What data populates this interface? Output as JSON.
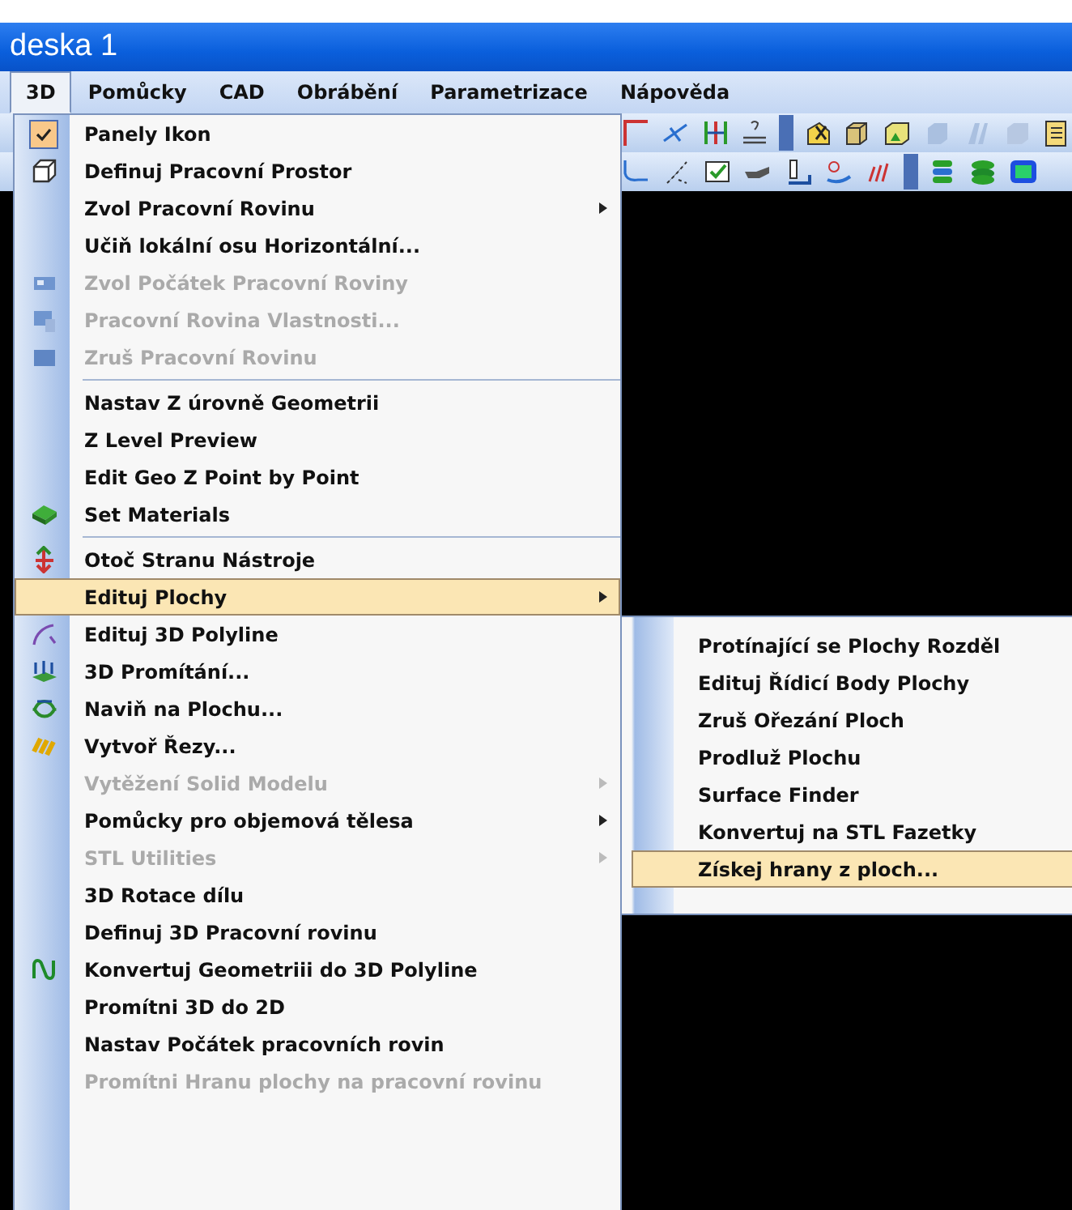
{
  "window": {
    "title": "deska 1"
  },
  "menubar": [
    {
      "label": "3D",
      "selected": true
    },
    {
      "label": "Pomůcky",
      "selected": false
    },
    {
      "label": "CAD",
      "selected": false
    },
    {
      "label": "Obrábění",
      "selected": false
    },
    {
      "label": "Parametrizace",
      "selected": false
    },
    {
      "label": "Nápověda",
      "selected": false
    }
  ],
  "dropdown": {
    "items": [
      {
        "kind": "item",
        "label": "Panely Ikon",
        "checked": true,
        "disabled": false,
        "submenu": false,
        "selected": false
      },
      {
        "kind": "item",
        "label": "Definuj Pracovní Prostor",
        "checked": false,
        "disabled": false,
        "submenu": false,
        "selected": false
      },
      {
        "kind": "item",
        "label": "Zvol Pracovní Rovinu",
        "checked": false,
        "disabled": false,
        "submenu": true,
        "selected": false
      },
      {
        "kind": "item",
        "label": "Učiň lokální osu Horizontální...",
        "checked": false,
        "disabled": false,
        "submenu": false,
        "selected": false
      },
      {
        "kind": "item",
        "label": "Zvol Počátek Pracovní Roviny",
        "checked": false,
        "disabled": true,
        "submenu": false,
        "selected": false
      },
      {
        "kind": "item",
        "label": "Pracovní Rovina Vlastnosti...",
        "checked": false,
        "disabled": true,
        "submenu": false,
        "selected": false
      },
      {
        "kind": "item",
        "label": "Zruš Pracovní Rovinu",
        "checked": false,
        "disabled": true,
        "submenu": false,
        "selected": false
      },
      {
        "kind": "separator"
      },
      {
        "kind": "item",
        "label": "Nastav Z úrovně Geometrii",
        "checked": false,
        "disabled": false,
        "submenu": false,
        "selected": false
      },
      {
        "kind": "item",
        "label": "Z Level Preview",
        "checked": false,
        "disabled": false,
        "submenu": false,
        "selected": false
      },
      {
        "kind": "item",
        "label": "Edit Geo Z Point by Point",
        "checked": false,
        "disabled": false,
        "submenu": false,
        "selected": false
      },
      {
        "kind": "item",
        "label": "Set Materials",
        "checked": false,
        "disabled": false,
        "submenu": false,
        "selected": false
      },
      {
        "kind": "separator"
      },
      {
        "kind": "item",
        "label": "Otoč Stranu Nástroje",
        "checked": false,
        "disabled": false,
        "submenu": false,
        "selected": false
      },
      {
        "kind": "item",
        "label": "Edituj Plochy",
        "checked": false,
        "disabled": false,
        "submenu": true,
        "selected": true
      },
      {
        "kind": "item",
        "label": "Edituj 3D Polyline",
        "checked": false,
        "disabled": false,
        "submenu": false,
        "selected": false
      },
      {
        "kind": "item",
        "label": "3D Promítání...",
        "checked": false,
        "disabled": false,
        "submenu": false,
        "selected": false
      },
      {
        "kind": "item",
        "label": "Naviň na Plochu...",
        "checked": false,
        "disabled": false,
        "submenu": false,
        "selected": false
      },
      {
        "kind": "item",
        "label": "Vytvoř Řezy...",
        "checked": false,
        "disabled": false,
        "submenu": false,
        "selected": false
      },
      {
        "kind": "item",
        "label": "Vytěžení Solid Modelu",
        "checked": false,
        "disabled": true,
        "submenu": true,
        "selected": false
      },
      {
        "kind": "item",
        "label": "Pomůcky pro objemová tělesa",
        "checked": false,
        "disabled": false,
        "submenu": true,
        "selected": false
      },
      {
        "kind": "item",
        "label": "STL Utilities",
        "checked": false,
        "disabled": true,
        "submenu": true,
        "selected": false
      },
      {
        "kind": "item",
        "label": "3D Rotace dílu",
        "checked": false,
        "disabled": false,
        "submenu": false,
        "selected": false
      },
      {
        "kind": "item",
        "label": "Definuj 3D Pracovní rovinu",
        "checked": false,
        "disabled": false,
        "submenu": false,
        "selected": false
      },
      {
        "kind": "item",
        "label": "Konvertuj Geometriii do 3D Polyline",
        "checked": false,
        "disabled": false,
        "submenu": false,
        "selected": false
      },
      {
        "kind": "item",
        "label": "Promítni 3D do 2D",
        "checked": false,
        "disabled": false,
        "submenu": false,
        "selected": false
      },
      {
        "kind": "item",
        "label": "Nastav Počátek pracovních rovin",
        "checked": false,
        "disabled": false,
        "submenu": false,
        "selected": false
      },
      {
        "kind": "item",
        "label": "Promítni Hranu plochy na pracovní rovinu",
        "checked": false,
        "disabled": true,
        "submenu": false,
        "selected": false
      }
    ]
  },
  "submenu": {
    "items": [
      {
        "label": "Protínající se Plochy Rozděl",
        "selected": false
      },
      {
        "label": "Edituj Řídicí Body Plochy",
        "selected": false
      },
      {
        "label": "Zruš Ořezání Ploch",
        "selected": false
      },
      {
        "label": "Prodluž Plochu",
        "selected": false
      },
      {
        "label": "Surface Finder",
        "selected": false
      },
      {
        "label": "Konvertuj na STL Fazetky",
        "selected": false
      },
      {
        "label": "Získej hrany z ploch...",
        "selected": true
      }
    ]
  }
}
